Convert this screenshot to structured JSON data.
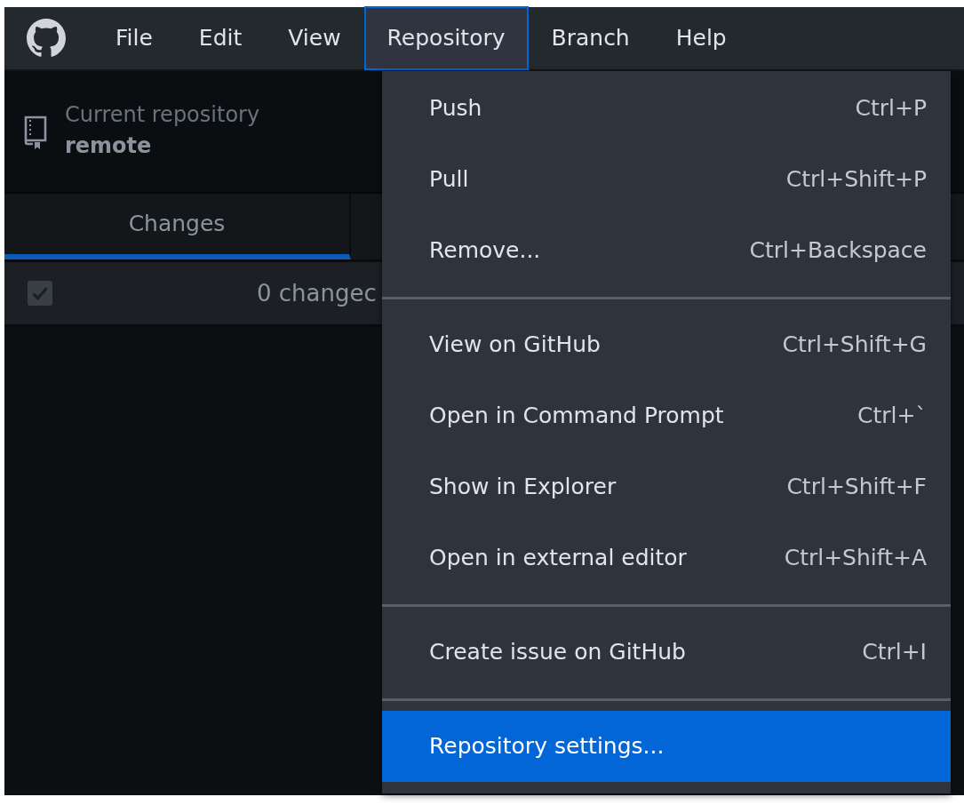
{
  "menu_bar": [
    {
      "label": "File",
      "selected": false
    },
    {
      "label": "Edit",
      "selected": false
    },
    {
      "label": "View",
      "selected": false
    },
    {
      "label": "Repository",
      "selected": true
    },
    {
      "label": "Branch",
      "selected": false
    },
    {
      "label": "Help",
      "selected": false
    }
  ],
  "repository_selector": {
    "caption": "Current repository",
    "name": "remote"
  },
  "tabs": [
    {
      "label": "Changes",
      "selected": true
    }
  ],
  "changes_header": {
    "checked": true,
    "disabled": true,
    "summary": "0 changec"
  },
  "dropdown_menu": [
    {
      "kind": "item",
      "label": "Push",
      "shortcut": "Ctrl+P",
      "selected": false
    },
    {
      "kind": "item",
      "label": "Pull",
      "shortcut": "Ctrl+Shift+P",
      "selected": false
    },
    {
      "kind": "item",
      "label": "Remove...",
      "shortcut": "Ctrl+Backspace",
      "selected": false
    },
    {
      "kind": "separator"
    },
    {
      "kind": "item",
      "label": "View on GitHub",
      "shortcut": "Ctrl+Shift+G",
      "selected": false
    },
    {
      "kind": "item",
      "label": "Open in Command Prompt",
      "shortcut": "Ctrl+`",
      "selected": false
    },
    {
      "kind": "item",
      "label": "Show in Explorer",
      "shortcut": "Ctrl+Shift+F",
      "selected": false
    },
    {
      "kind": "item",
      "label": "Open in external editor",
      "shortcut": "Ctrl+Shift+A",
      "selected": false
    },
    {
      "kind": "separator"
    },
    {
      "kind": "item",
      "label": "Create issue on GitHub",
      "shortcut": "Ctrl+I",
      "selected": false
    },
    {
      "kind": "separator"
    },
    {
      "kind": "item",
      "label": "Repository settings...",
      "selected": true
    }
  ]
}
